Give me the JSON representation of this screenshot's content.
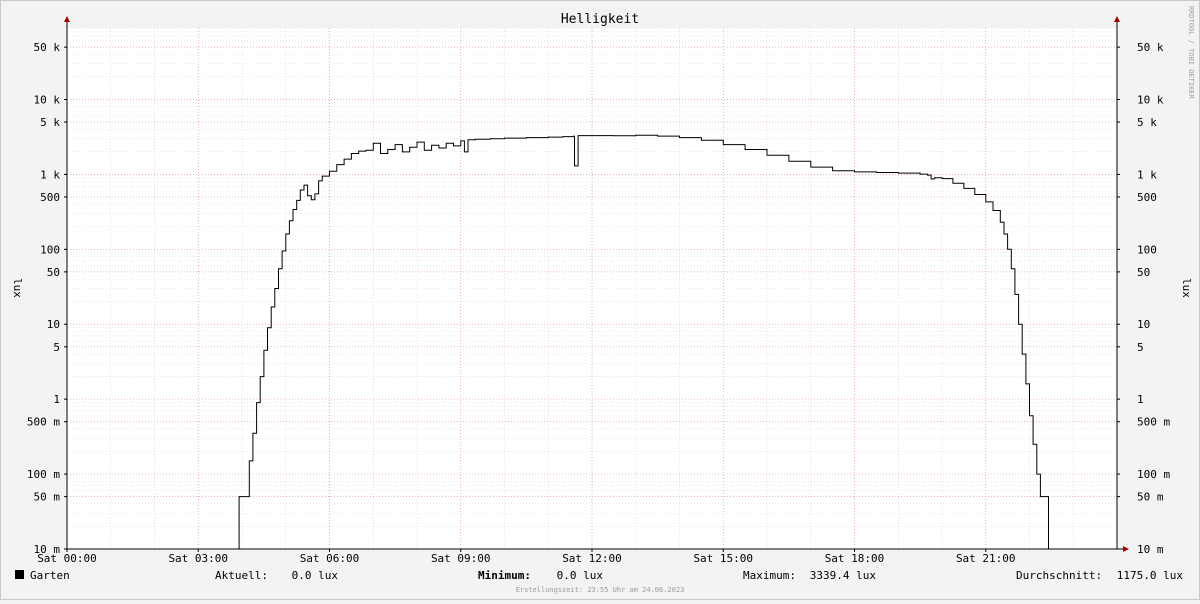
{
  "chart_data": {
    "type": "line",
    "title": "Helligkeit",
    "ylabel_left": "lux",
    "ylabel_right": "lux",
    "watermark": "RRDTOOL / TOBI OETIKER",
    "y_scale": "log",
    "ylim": [
      0.01,
      90000
    ],
    "y_ticks": [
      {
        "value": 0.01,
        "label": "10 m"
      },
      {
        "value": 0.05,
        "label": "50 m"
      },
      {
        "value": 0.1,
        "label": "100 m"
      },
      {
        "value": 0.5,
        "label": "500 m"
      },
      {
        "value": 1,
        "label": "1"
      },
      {
        "value": 5,
        "label": "5"
      },
      {
        "value": 10,
        "label": "10"
      },
      {
        "value": 50,
        "label": "50"
      },
      {
        "value": 100,
        "label": "100"
      },
      {
        "value": 500,
        "label": "500"
      },
      {
        "value": 1000,
        "label": "1 k"
      },
      {
        "value": 5000,
        "label": "5 k"
      },
      {
        "value": 10000,
        "label": "10 k"
      },
      {
        "value": 50000,
        "label": "50 k"
      }
    ],
    "xlim": [
      "00:00",
      "24:00"
    ],
    "x_ticks": [
      {
        "hour": 0,
        "label": "Sat 00:00"
      },
      {
        "hour": 3,
        "label": "Sat 03:00"
      },
      {
        "hour": 6,
        "label": "Sat 06:00"
      },
      {
        "hour": 9,
        "label": "Sat 09:00"
      },
      {
        "hour": 12,
        "label": "Sat 12:00"
      },
      {
        "hour": 15,
        "label": "Sat 15:00"
      },
      {
        "hour": 18,
        "label": "Sat 18:00"
      },
      {
        "hour": 21,
        "label": "Sat 21:00"
      }
    ],
    "grid": true,
    "series": [
      {
        "name": "Garten",
        "color": "#000000",
        "points": [
          [
            "00:00",
            0.01
          ],
          [
            "03:55",
            0.01
          ],
          [
            "03:56",
            0.05
          ],
          [
            "04:05",
            0.05
          ],
          [
            "04:10",
            0.15
          ],
          [
            "04:15",
            0.35
          ],
          [
            "04:20",
            0.9
          ],
          [
            "04:25",
            2
          ],
          [
            "04:30",
            4.5
          ],
          [
            "04:35",
            9
          ],
          [
            "04:40",
            17
          ],
          [
            "04:45",
            30
          ],
          [
            "04:50",
            55
          ],
          [
            "04:55",
            95
          ],
          [
            "05:00",
            160
          ],
          [
            "05:05",
            240
          ],
          [
            "05:10",
            340
          ],
          [
            "05:15",
            450
          ],
          [
            "05:20",
            620
          ],
          [
            "05:25",
            720
          ],
          [
            "05:30",
            520
          ],
          [
            "05:35",
            460
          ],
          [
            "05:40",
            550
          ],
          [
            "05:45",
            820
          ],
          [
            "05:50",
            950
          ],
          [
            "06:00",
            1100
          ],
          [
            "06:10",
            1350
          ],
          [
            "06:20",
            1600
          ],
          [
            "06:30",
            1900
          ],
          [
            "06:40",
            2050
          ],
          [
            "06:50",
            2100
          ],
          [
            "07:00",
            2600
          ],
          [
            "07:10",
            1900
          ],
          [
            "07:20",
            2150
          ],
          [
            "07:30",
            2500
          ],
          [
            "07:40",
            2000
          ],
          [
            "07:50",
            2300
          ],
          [
            "08:00",
            2700
          ],
          [
            "08:10",
            2100
          ],
          [
            "08:20",
            2450
          ],
          [
            "08:30",
            2250
          ],
          [
            "08:40",
            2600
          ],
          [
            "08:50",
            2400
          ],
          [
            "09:00",
            2800
          ],
          [
            "09:05",
            2000
          ],
          [
            "09:10",
            2900
          ],
          [
            "09:20",
            2950
          ],
          [
            "09:40",
            3000
          ],
          [
            "10:00",
            3050
          ],
          [
            "10:30",
            3100
          ],
          [
            "11:00",
            3150
          ],
          [
            "11:20",
            3200
          ],
          [
            "11:35",
            3250
          ],
          [
            "11:36",
            1300
          ],
          [
            "11:40",
            1300
          ],
          [
            "11:41",
            3300
          ],
          [
            "12:00",
            3300
          ],
          [
            "12:30",
            3280
          ],
          [
            "13:00",
            3339.4
          ],
          [
            "13:30",
            3250
          ],
          [
            "14:00",
            3100
          ],
          [
            "14:30",
            2850
          ],
          [
            "15:00",
            2500
          ],
          [
            "15:30",
            2150
          ],
          [
            "16:00",
            1800
          ],
          [
            "16:30",
            1500
          ],
          [
            "17:00",
            1250
          ],
          [
            "17:30",
            1120
          ],
          [
            "18:00",
            1080
          ],
          [
            "18:30",
            1060
          ],
          [
            "19:00",
            1040
          ],
          [
            "19:30",
            1010
          ],
          [
            "19:40",
            980
          ],
          [
            "19:45",
            870
          ],
          [
            "19:50",
            900
          ],
          [
            "20:00",
            880
          ],
          [
            "20:15",
            760
          ],
          [
            "20:30",
            650
          ],
          [
            "20:45",
            540
          ],
          [
            "21:00",
            430
          ],
          [
            "21:10",
            330
          ],
          [
            "21:20",
            230
          ],
          [
            "21:25",
            160
          ],
          [
            "21:30",
            100
          ],
          [
            "21:35",
            55
          ],
          [
            "21:40",
            25
          ],
          [
            "21:45",
            10
          ],
          [
            "21:50",
            4
          ],
          [
            "21:55",
            1.6
          ],
          [
            "22:00",
            0.6
          ],
          [
            "22:05",
            0.25
          ],
          [
            "22:10",
            0.1
          ],
          [
            "22:15",
            0.05
          ],
          [
            "22:25",
            0.05
          ],
          [
            "22:26",
            0.01
          ],
          [
            "23:00",
            0.01
          ]
        ]
      }
    ]
  },
  "legend": {
    "series_name": "Garten",
    "color": "#000000",
    "current_label": "Aktuell:",
    "current_value": "0.0 lux",
    "minimum_label": "Minimum:",
    "minimum_value": "0.0 lux",
    "maximum_label": "Maximum:",
    "maximum_value": "3339.4 lux",
    "average_label": "Durchschnitt:",
    "average_value": "1175.0 lux"
  },
  "footer": {
    "created": "Erstellungszeit: 23:55 Uhr am 24.06.2023"
  }
}
